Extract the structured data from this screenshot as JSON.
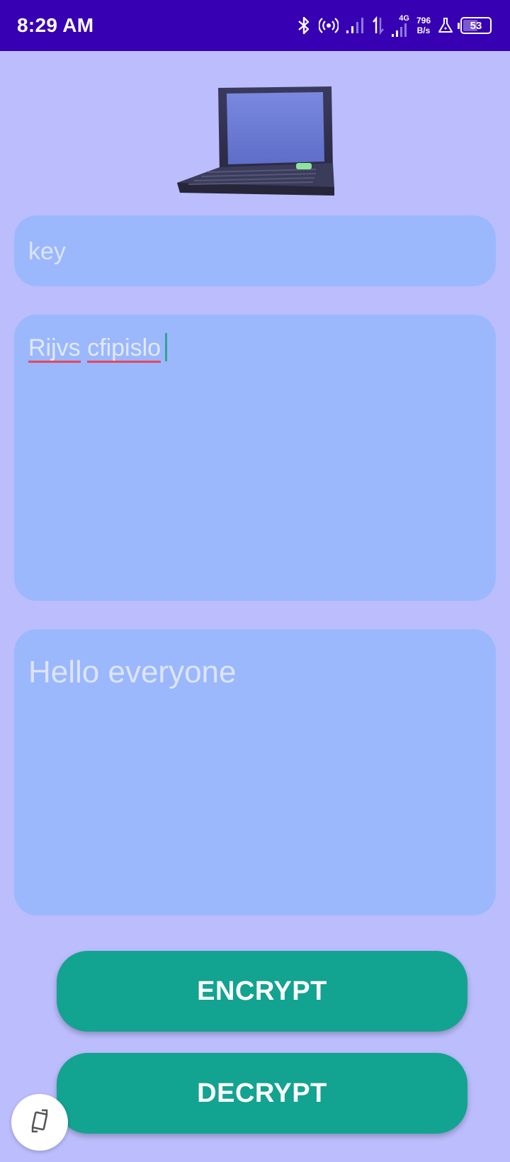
{
  "status_bar": {
    "time": "8:29 AM",
    "network_type": "4G",
    "net_speed_value": "796",
    "net_speed_unit": "B/s",
    "battery_level": "53",
    "icons": [
      "bluetooth-icon",
      "hotspot-icon",
      "signal-icon",
      "data-transfer-icon",
      "signal-4g-icon",
      "lab-flask-icon",
      "battery-icon"
    ]
  },
  "header_image": {
    "icon": "laptop-icon"
  },
  "key_field": {
    "value": "key"
  },
  "cipher_field": {
    "words": [
      "Rijvs",
      "cfipislo"
    ]
  },
  "plain_field": {
    "value": "Hello everyone"
  },
  "buttons": {
    "encrypt_label": "ENCRYPT",
    "decrypt_label": "DECRYPT"
  },
  "fab": {
    "icon": "rotate-screen-icon"
  },
  "colors": {
    "background": "#bbbdfd",
    "status_bar": "#3700b3",
    "field": "#9bb8fd",
    "button": "#13a391",
    "spell_underline": "#e5475b"
  }
}
